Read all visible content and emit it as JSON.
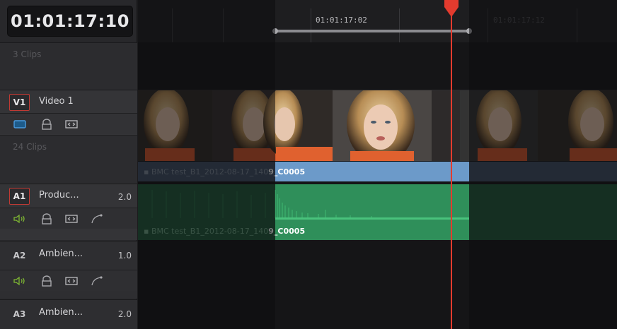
{
  "header": {
    "timecode": "01:01:17:10",
    "clips_count_label": "3 Clips"
  },
  "tracks": {
    "v1": {
      "badge": "V1",
      "name": "Video 1",
      "clips_label": "24 Clips"
    },
    "a1": {
      "badge": "A1",
      "name": "Produc...",
      "value": "2.0"
    },
    "a2": {
      "badge": "A2",
      "name": "Ambien...",
      "value": "1.0"
    },
    "a3": {
      "badge": "A3",
      "name": "Ambien...",
      "value": "2.0"
    }
  },
  "ruler": {
    "tc_left": "01:01:17:02",
    "tc_right": "01:01:17:12"
  },
  "clips": {
    "video_name_prefix": "BMC test_B1_2012-08-17_140",
    "video_name_suffix": "9_C0005",
    "audio_name_prefix": "BMC test_B1_2012-08-17_140",
    "audio_name_suffix": "9_C0005"
  },
  "colors": {
    "record_badge": "#c13a34",
    "video_clip": "#6c9ac9",
    "audio_clip": "#2f8f5a",
    "playhead": "#e33b2e",
    "speaker_icon": "#7fb833"
  },
  "icons": [
    "video-toggle-icon",
    "lock-icon",
    "auto-select-icon",
    "speaker-icon",
    "curve-icon",
    "playhead-marker-icon"
  ]
}
